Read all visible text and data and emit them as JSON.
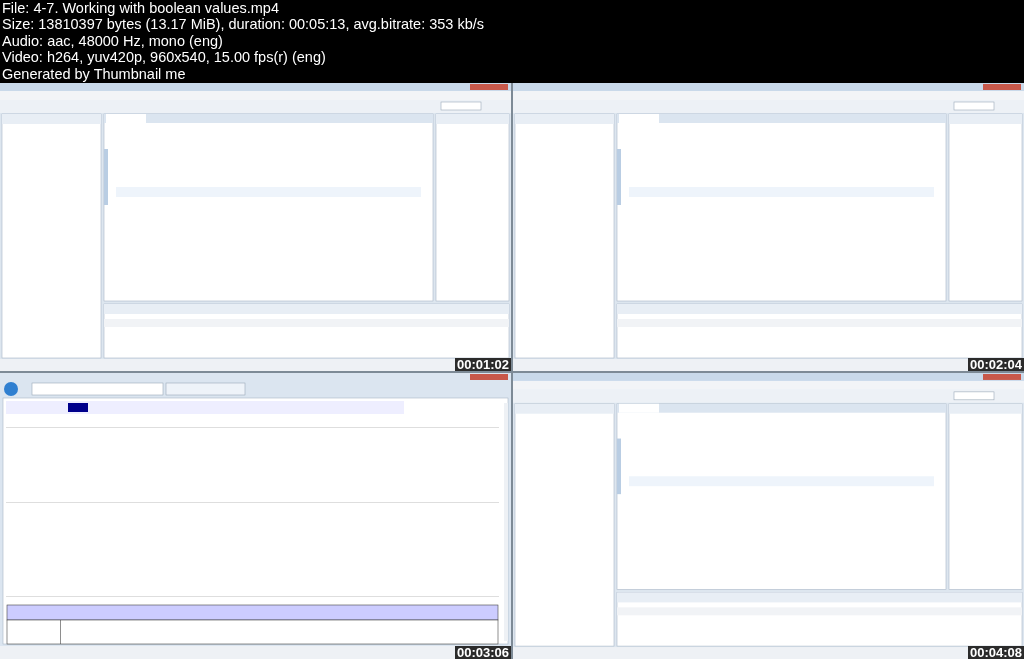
{
  "header": {
    "lines": [
      "File: 4-7. Working with boolean values.mp4",
      "Size: 13810397 bytes (13.17 MiB), duration: 00:05:13, avg.bitrate: 353 kb/s",
      "Audio: aac, 48000 Hz, mono (eng)",
      "Video: h264, yuv420p, 960x540, 15.00 fps(r) (eng)",
      "Generated by Thumbnail me"
    ]
  },
  "thumbnails": [
    {
      "kind": "ide",
      "timestamp": "00:01:02"
    },
    {
      "kind": "ide",
      "timestamp": "00:02:04"
    },
    {
      "kind": "browser",
      "timestamp": "00:03:06"
    },
    {
      "kind": "ide",
      "timestamp": "00:04:08"
    }
  ]
}
